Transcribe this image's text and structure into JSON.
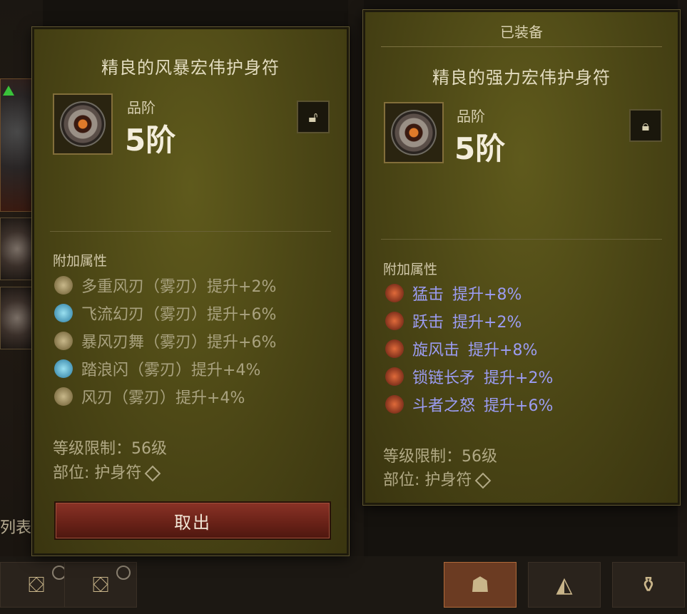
{
  "left_panel": {
    "title": "精良的风暴宏伟护身符",
    "icon": "storm-amulet-icon",
    "grade_label": "品阶",
    "grade_value": "5阶",
    "lock_state": "unlocked",
    "affix_heading": "附加属性",
    "affixes": [
      {
        "name": "多重风刃（雾刃）",
        "bonus": "提升+2%",
        "icon": "multi-wind-blade-icon"
      },
      {
        "name": "飞流幻刃（雾刃）",
        "bonus": "提升+6%",
        "icon": "flying-phantom-blade-icon"
      },
      {
        "name": "暴风刃舞（雾刃）",
        "bonus": "提升+6%",
        "icon": "storm-blade-dance-icon"
      },
      {
        "name": "踏浪闪（雾刃）",
        "bonus": "提升+4%",
        "icon": "wave-step-flash-icon"
      },
      {
        "name": "风刃（雾刃）",
        "bonus": "提升+4%",
        "icon": "wind-blade-icon"
      }
    ],
    "level_req": "等级限制：56级",
    "slot": "部位: 护身符",
    "withdraw_label": "取出"
  },
  "right_panel": {
    "header": "已装备",
    "title": "精良的强力宏伟护身符",
    "icon": "mighty-amulet-icon",
    "grade_label": "品阶",
    "grade_value": "5阶",
    "lock_state": "locked",
    "affix_heading": "附加属性",
    "affixes": [
      {
        "name": "猛击",
        "bonus": "提升+8%",
        "icon": "bash-icon"
      },
      {
        "name": "跃击",
        "bonus": "提升+2%",
        "icon": "leap-strike-icon"
      },
      {
        "name": "旋风击",
        "bonus": "提升+8%",
        "icon": "whirlwind-icon"
      },
      {
        "name": "锁链长矛",
        "bonus": "提升+2%",
        "icon": "chain-spear-icon"
      },
      {
        "name": "斗者之怒",
        "bonus": "提升+6%",
        "icon": "fighter-rage-icon"
      }
    ],
    "level_req": "等级限制：56级",
    "slot": "部位: 护身符"
  },
  "background": {
    "partial_text": "列表"
  },
  "bottom_bar": {
    "slots": [
      {
        "icon": "stash-chest-icon",
        "active": false
      },
      {
        "icon": "stash-chest-icon",
        "active": false
      },
      {
        "icon": "helmet-icon",
        "active": true
      },
      {
        "icon": "crafting-material-icon",
        "active": false
      },
      {
        "icon": "gold-bag-icon",
        "active": false
      }
    ]
  },
  "colors": {
    "panel_bg": "#4a4515",
    "affix_blue": "#9b9cf2",
    "affix_muted": "#a9a27f",
    "withdraw_button": "#6a2218"
  }
}
